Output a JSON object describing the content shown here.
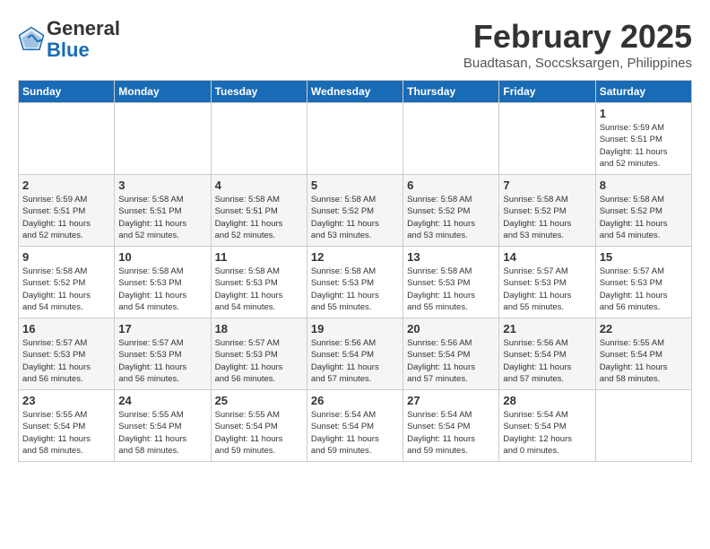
{
  "header": {
    "logo_line1": "General",
    "logo_line2": "Blue",
    "month_title": "February 2025",
    "location": "Buadtasan, Soccsksargen, Philippines"
  },
  "days_of_week": [
    "Sunday",
    "Monday",
    "Tuesday",
    "Wednesday",
    "Thursday",
    "Friday",
    "Saturday"
  ],
  "weeks": [
    [
      {
        "day": "",
        "info": ""
      },
      {
        "day": "",
        "info": ""
      },
      {
        "day": "",
        "info": ""
      },
      {
        "day": "",
        "info": ""
      },
      {
        "day": "",
        "info": ""
      },
      {
        "day": "",
        "info": ""
      },
      {
        "day": "1",
        "info": "Sunrise: 5:59 AM\nSunset: 5:51 PM\nDaylight: 11 hours\nand 52 minutes."
      }
    ],
    [
      {
        "day": "2",
        "info": "Sunrise: 5:59 AM\nSunset: 5:51 PM\nDaylight: 11 hours\nand 52 minutes."
      },
      {
        "day": "3",
        "info": "Sunrise: 5:58 AM\nSunset: 5:51 PM\nDaylight: 11 hours\nand 52 minutes."
      },
      {
        "day": "4",
        "info": "Sunrise: 5:58 AM\nSunset: 5:51 PM\nDaylight: 11 hours\nand 52 minutes."
      },
      {
        "day": "5",
        "info": "Sunrise: 5:58 AM\nSunset: 5:52 PM\nDaylight: 11 hours\nand 53 minutes."
      },
      {
        "day": "6",
        "info": "Sunrise: 5:58 AM\nSunset: 5:52 PM\nDaylight: 11 hours\nand 53 minutes."
      },
      {
        "day": "7",
        "info": "Sunrise: 5:58 AM\nSunset: 5:52 PM\nDaylight: 11 hours\nand 53 minutes."
      },
      {
        "day": "8",
        "info": "Sunrise: 5:58 AM\nSunset: 5:52 PM\nDaylight: 11 hours\nand 54 minutes."
      }
    ],
    [
      {
        "day": "9",
        "info": "Sunrise: 5:58 AM\nSunset: 5:52 PM\nDaylight: 11 hours\nand 54 minutes."
      },
      {
        "day": "10",
        "info": "Sunrise: 5:58 AM\nSunset: 5:53 PM\nDaylight: 11 hours\nand 54 minutes."
      },
      {
        "day": "11",
        "info": "Sunrise: 5:58 AM\nSunset: 5:53 PM\nDaylight: 11 hours\nand 54 minutes."
      },
      {
        "day": "12",
        "info": "Sunrise: 5:58 AM\nSunset: 5:53 PM\nDaylight: 11 hours\nand 55 minutes."
      },
      {
        "day": "13",
        "info": "Sunrise: 5:58 AM\nSunset: 5:53 PM\nDaylight: 11 hours\nand 55 minutes."
      },
      {
        "day": "14",
        "info": "Sunrise: 5:57 AM\nSunset: 5:53 PM\nDaylight: 11 hours\nand 55 minutes."
      },
      {
        "day": "15",
        "info": "Sunrise: 5:57 AM\nSunset: 5:53 PM\nDaylight: 11 hours\nand 56 minutes."
      }
    ],
    [
      {
        "day": "16",
        "info": "Sunrise: 5:57 AM\nSunset: 5:53 PM\nDaylight: 11 hours\nand 56 minutes."
      },
      {
        "day": "17",
        "info": "Sunrise: 5:57 AM\nSunset: 5:53 PM\nDaylight: 11 hours\nand 56 minutes."
      },
      {
        "day": "18",
        "info": "Sunrise: 5:57 AM\nSunset: 5:53 PM\nDaylight: 11 hours\nand 56 minutes."
      },
      {
        "day": "19",
        "info": "Sunrise: 5:56 AM\nSunset: 5:54 PM\nDaylight: 11 hours\nand 57 minutes."
      },
      {
        "day": "20",
        "info": "Sunrise: 5:56 AM\nSunset: 5:54 PM\nDaylight: 11 hours\nand 57 minutes."
      },
      {
        "day": "21",
        "info": "Sunrise: 5:56 AM\nSunset: 5:54 PM\nDaylight: 11 hours\nand 57 minutes."
      },
      {
        "day": "22",
        "info": "Sunrise: 5:55 AM\nSunset: 5:54 PM\nDaylight: 11 hours\nand 58 minutes."
      }
    ],
    [
      {
        "day": "23",
        "info": "Sunrise: 5:55 AM\nSunset: 5:54 PM\nDaylight: 11 hours\nand 58 minutes."
      },
      {
        "day": "24",
        "info": "Sunrise: 5:55 AM\nSunset: 5:54 PM\nDaylight: 11 hours\nand 58 minutes."
      },
      {
        "day": "25",
        "info": "Sunrise: 5:55 AM\nSunset: 5:54 PM\nDaylight: 11 hours\nand 59 minutes."
      },
      {
        "day": "26",
        "info": "Sunrise: 5:54 AM\nSunset: 5:54 PM\nDaylight: 11 hours\nand 59 minutes."
      },
      {
        "day": "27",
        "info": "Sunrise: 5:54 AM\nSunset: 5:54 PM\nDaylight: 11 hours\nand 59 minutes."
      },
      {
        "day": "28",
        "info": "Sunrise: 5:54 AM\nSunset: 5:54 PM\nDaylight: 12 hours\nand 0 minutes."
      },
      {
        "day": "",
        "info": ""
      }
    ]
  ]
}
